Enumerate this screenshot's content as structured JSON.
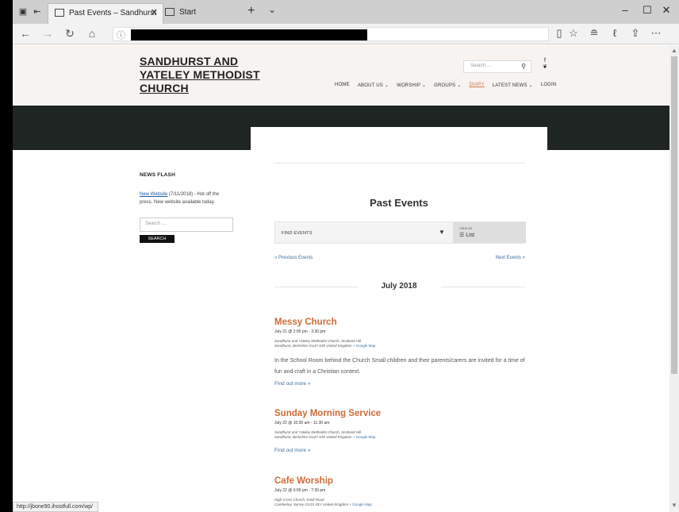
{
  "browser": {
    "tabs": [
      {
        "title": "Past Events – Sandhurst"
      },
      {
        "title": "Start"
      }
    ],
    "new_tab": "+",
    "tab_dropdown": "⌄",
    "window_controls": {
      "minimize": "–",
      "maximize": "☐",
      "close": "✕"
    },
    "url_info_icon": "ⓘ",
    "status_url": "http://jbone90.ihostfull.com/wp/"
  },
  "site": {
    "title": "SANDHURST AND YATELEY METHODIST CHURCH",
    "search_placeholder": "Search …",
    "social": {
      "facebook": "f",
      "twitter": "❦"
    },
    "nav": [
      {
        "label": "HOME"
      },
      {
        "label": "ABOUT US ⌄"
      },
      {
        "label": "WORSHIP ⌄"
      },
      {
        "label": "GROUPS ⌄"
      },
      {
        "label": "DIARY"
      },
      {
        "label": "LATEST NEWS ⌄"
      },
      {
        "label": "LOGIN"
      }
    ]
  },
  "sidebar": {
    "heading": "NEWS FLASH",
    "news_link": "New Website",
    "news_text": " (7/11/2018) - Hot off the press. New website available today.",
    "search_placeholder": "Search …",
    "search_button": "SEARCH"
  },
  "events_page": {
    "heading": "Past Events",
    "find_events": "FIND EVENTS",
    "view_as_label": "VIEW AS",
    "view_as_value": "☰ List",
    "prev_link": "« Previous Events",
    "next_link": "Next Events »",
    "month": "July 2018",
    "events": [
      {
        "title": "Messy Church",
        "date": "July 21 @ 2:00 pm - 3:30 pm",
        "venue_line1": "Sandhurst and Yateley Methodist Church, Scotland Hill",
        "venue_line2": "Sandhurst, Berkshire GU47 8JR United Kingdom",
        "map_link": "+ Google Map",
        "description": "In the School Room behind the Church Small children and their parents/carers are invited for a time of fun and craft in a Christian context.",
        "more": "Find out more »"
      },
      {
        "title": "Sunday Morning Service",
        "date": "July 22 @ 10:30 am - 11:30 am",
        "venue_line1": "Sandhurst and Yateley Methodist Church, Scotland Hill",
        "venue_line2": "Sandhurst, Berkshire GU47 8JR United Kingdom",
        "map_link": "+ Google Map",
        "more": "Find out more »"
      },
      {
        "title": "Cafe Worship",
        "date": "July 22 @ 6:00 pm - 7:30 pm",
        "venue_line1": "High Cross Church, Knoll Road",
        "venue_line2": "Camberley, Surrey GU15 3SY United Kingdom",
        "map_link": "+ Google Map"
      }
    ]
  }
}
